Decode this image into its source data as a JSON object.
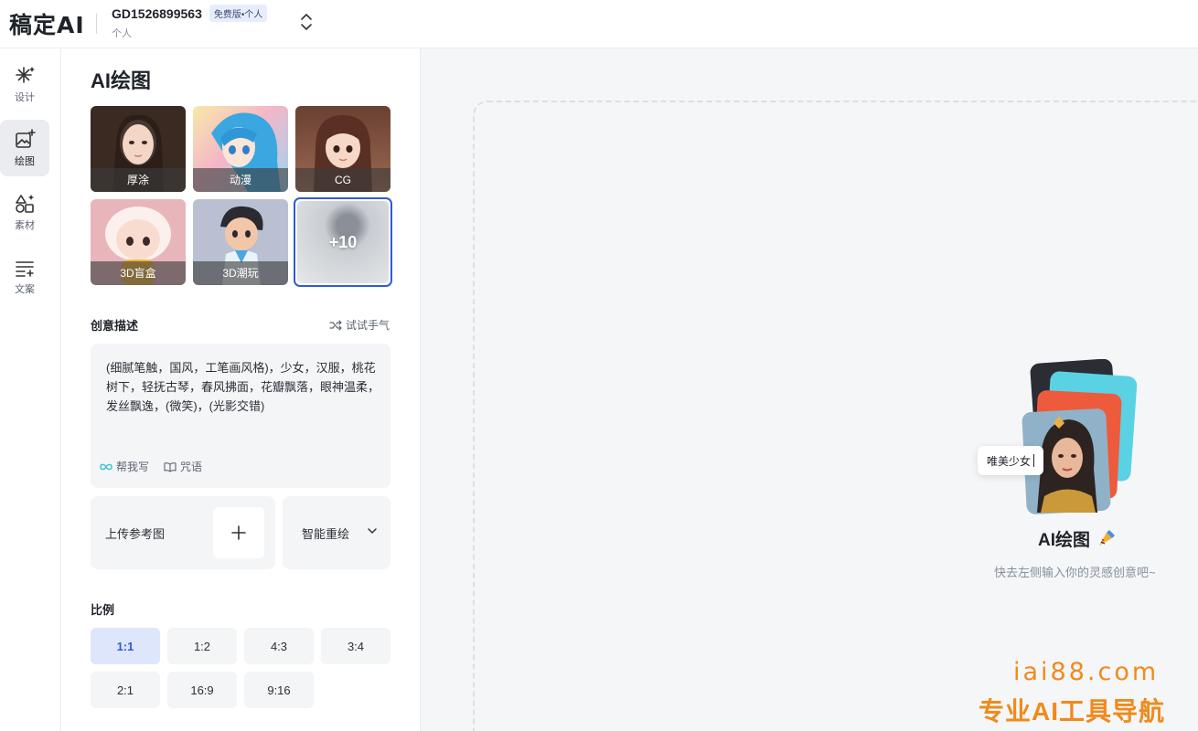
{
  "app": {
    "logo": "稿定AI"
  },
  "account": {
    "id": "GD1526899563",
    "badge": "免费版•个人",
    "type": "个人"
  },
  "nav": {
    "items": [
      {
        "label": "设计",
        "icon": "sparkle-icon"
      },
      {
        "label": "绘图",
        "icon": "image-plus-icon",
        "active": true
      },
      {
        "label": "素材",
        "icon": "shapes-icon"
      },
      {
        "label": "文案",
        "icon": "text-lines-icon"
      }
    ]
  },
  "panel": {
    "title": "AI绘图",
    "styles": [
      {
        "label": "厚涂"
      },
      {
        "label": "动漫"
      },
      {
        "label": "CG"
      },
      {
        "label": "3D盲盒"
      },
      {
        "label": "3D潮玩"
      }
    ],
    "more_label": "+10",
    "prompt": {
      "section_label": "创意描述",
      "try_luck": "试试手气",
      "text": "(细腻笔触，国风，工笔画风格)，少女，汉服，桃花树下，轻抚古琴，春风拂面，花瓣飘落，眼神温柔，发丝飘逸，(微笑)，(光影交错)",
      "help_write": "帮我写",
      "spells": "咒语"
    },
    "upload_label": "上传参考图",
    "redraw_label": "智能重绘",
    "ratio": {
      "section_label": "比例",
      "options": [
        "1:1",
        "1:2",
        "4:3",
        "3:4",
        "2:1",
        "16:9",
        "9:16"
      ],
      "selected": "1:1"
    }
  },
  "main": {
    "tag_chip": "唯美少女",
    "empty_title": "AI绘图",
    "empty_subtitle": "快去左侧输入你的灵感创意吧~"
  },
  "watermark": {
    "url": "iai88.com",
    "text": "专业AI工具导航"
  },
  "colors": {
    "accent": "#2f5bd8",
    "selected_bg": "#dde6fb",
    "watermark": "#f08a1b"
  }
}
